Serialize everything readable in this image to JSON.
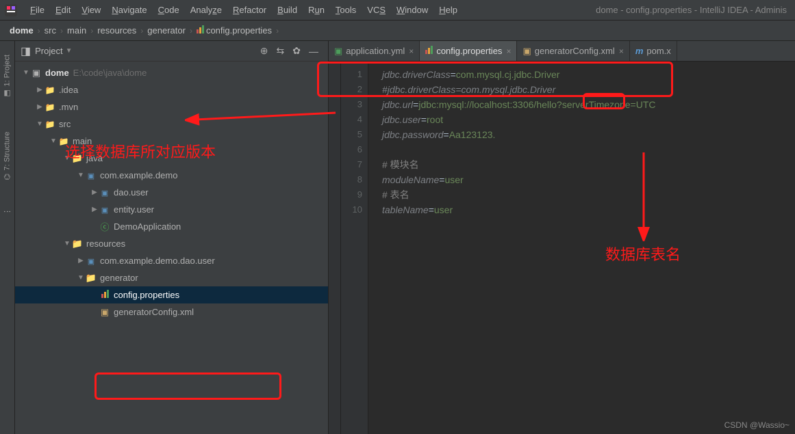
{
  "menubar": {
    "items": [
      "File",
      "Edit",
      "View",
      "Navigate",
      "Code",
      "Analyze",
      "Refactor",
      "Build",
      "Run",
      "Tools",
      "VCS",
      "Window",
      "Help"
    ],
    "title": "dome - config.properties - IntelliJ IDEA - Adminis"
  },
  "breadcrumb": [
    "dome",
    "src",
    "main",
    "resources",
    "generator",
    "config.properties"
  ],
  "sidebar_tools": {
    "project": "1: Project",
    "structure": "7: Structure"
  },
  "project_panel": {
    "title": "Project"
  },
  "tree": {
    "root": {
      "name": "dome",
      "path": "E:\\code\\java\\dome"
    },
    "idea": ".idea",
    "mvn": ".mvn",
    "src": "src",
    "main_f": "main",
    "java_f": "java",
    "pkg": "com.example.demo",
    "dao": "dao.user",
    "entity": "entity.user",
    "demoapp": "DemoApplication",
    "resources": "resources",
    "daouser_pkg": "com.example.demo.dao.user",
    "generator": "generator",
    "config_prop": "config.properties",
    "gen_xml": "generatorConfig.xml"
  },
  "tabs": [
    {
      "label": "application.yml",
      "icon": "yml",
      "active": false
    },
    {
      "label": "config.properties",
      "icon": "prop",
      "active": true
    },
    {
      "label": "generatorConfig.xml",
      "icon": "xml",
      "active": false
    },
    {
      "label": "pom.x",
      "icon": "m",
      "active": false
    }
  ],
  "code": {
    "lines": [
      {
        "n": 1,
        "k": "jdbc.driverClass",
        "v": "com.mysql.cj.jdbc.Driver"
      },
      {
        "n": 2,
        "cmt": "#jdbc.driverClass=com.mysql.jdbc.Driver"
      },
      {
        "n": 3,
        "k_pre": "jdbc.url",
        "v_pre": "jdbc:mysql://localhost:3306/",
        "v_hl": "hello?",
        "v_post": "serverTimezone=UTC"
      },
      {
        "n": 4,
        "k": "jdbc.user",
        "v": "root"
      },
      {
        "n": 5,
        "k": "jdbc.password",
        "v": "Aa123123."
      },
      {
        "n": 6,
        "blank": true
      },
      {
        "n": 7,
        "cmt": "# 模块名"
      },
      {
        "n": 8,
        "k": "moduleName",
        "v": "user"
      },
      {
        "n": 9,
        "cmt": "# 表名"
      },
      {
        "n": 10,
        "k": "tableName",
        "v": "user"
      }
    ]
  },
  "annotations": {
    "text1": "选择数据库所对应版本",
    "text2": "数据库表名"
  },
  "watermark": "CSDN @Wassio~"
}
